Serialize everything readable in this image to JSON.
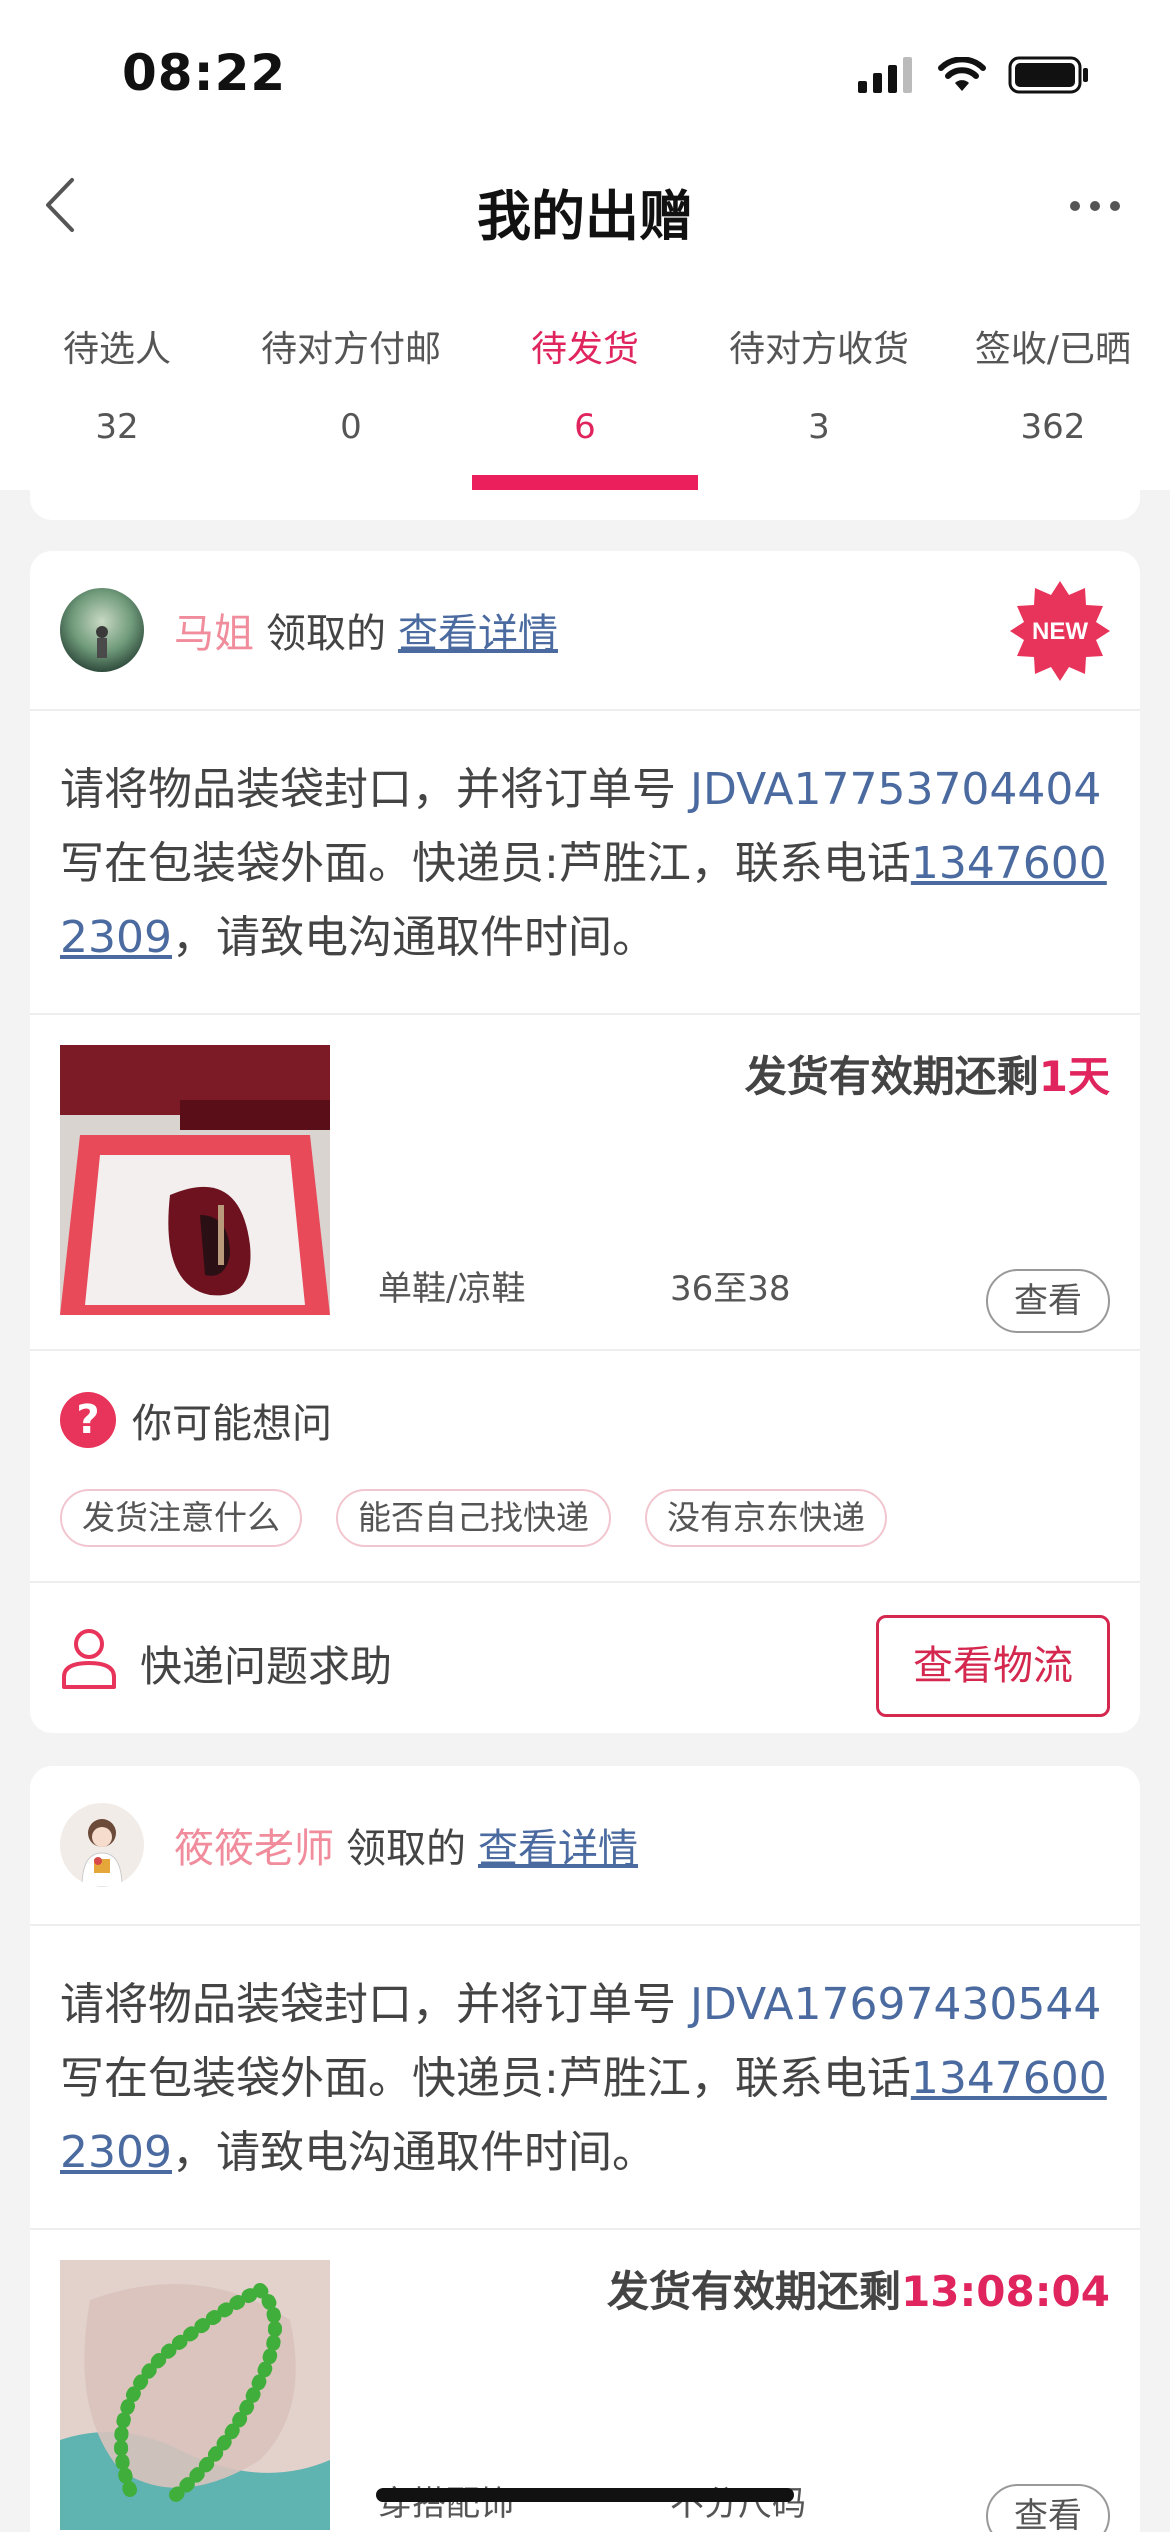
{
  "status_bar": {
    "time": "08:22"
  },
  "nav": {
    "title": "我的出赠"
  },
  "tabs": [
    {
      "label": "待选人",
      "count": "32"
    },
    {
      "label": "待对方付邮",
      "count": "0"
    },
    {
      "label": "待发货",
      "count": "6",
      "active": true
    },
    {
      "label": "待对方收货",
      "count": "3"
    },
    {
      "label": "签收/已晒",
      "count": "362"
    }
  ],
  "cards": [
    {
      "claimer": "马姐",
      "claimed_text": "领取的",
      "detail_link": "查看详情",
      "badge": "NEW",
      "instr_prefix": "请将物品装袋封口，并将订单号 ",
      "order_no": "JDVA17753704404",
      "instr_mid": " 写在包装袋外面。快递员:芦胜江，联系电话",
      "phone": "13476002309",
      "instr_suffix": "，请致电沟通取件时间。",
      "deadline_label": "发货有效期还剩",
      "deadline_value": "1天",
      "category": "单鞋/凉鞋",
      "size": "36至38",
      "view_label": "查看",
      "faq_title": "你可能想问",
      "faq_chips": [
        "发货注意什么",
        "能否自己找快递",
        "没有京东快递"
      ],
      "help_text": "快递问题求助",
      "logistics_label": "查看物流"
    },
    {
      "claimer": "筱筱老师",
      "claimed_text": "领取的",
      "detail_link": "查看详情",
      "instr_prefix": "请将物品装袋封口，并将订单号 ",
      "order_no": "JDVA17697430544",
      "instr_mid": " 写在包装袋外面。快递员:芦胜江，联系电话",
      "phone": "13476002309",
      "instr_suffix": "，请致电沟通取件时间。",
      "deadline_label": "发货有效期还剩",
      "deadline_value": "13:08:04",
      "category": "穿搭配饰",
      "size": "不分尺码",
      "view_label": "查看"
    }
  ],
  "colors": {
    "accent": "#e0245e",
    "link": "#4a6aa0",
    "name": "#f08c9b"
  },
  "icons": [
    "back-icon",
    "more-icon",
    "signal-icon",
    "wifi-icon",
    "battery-icon",
    "question-icon",
    "person-icon"
  ]
}
